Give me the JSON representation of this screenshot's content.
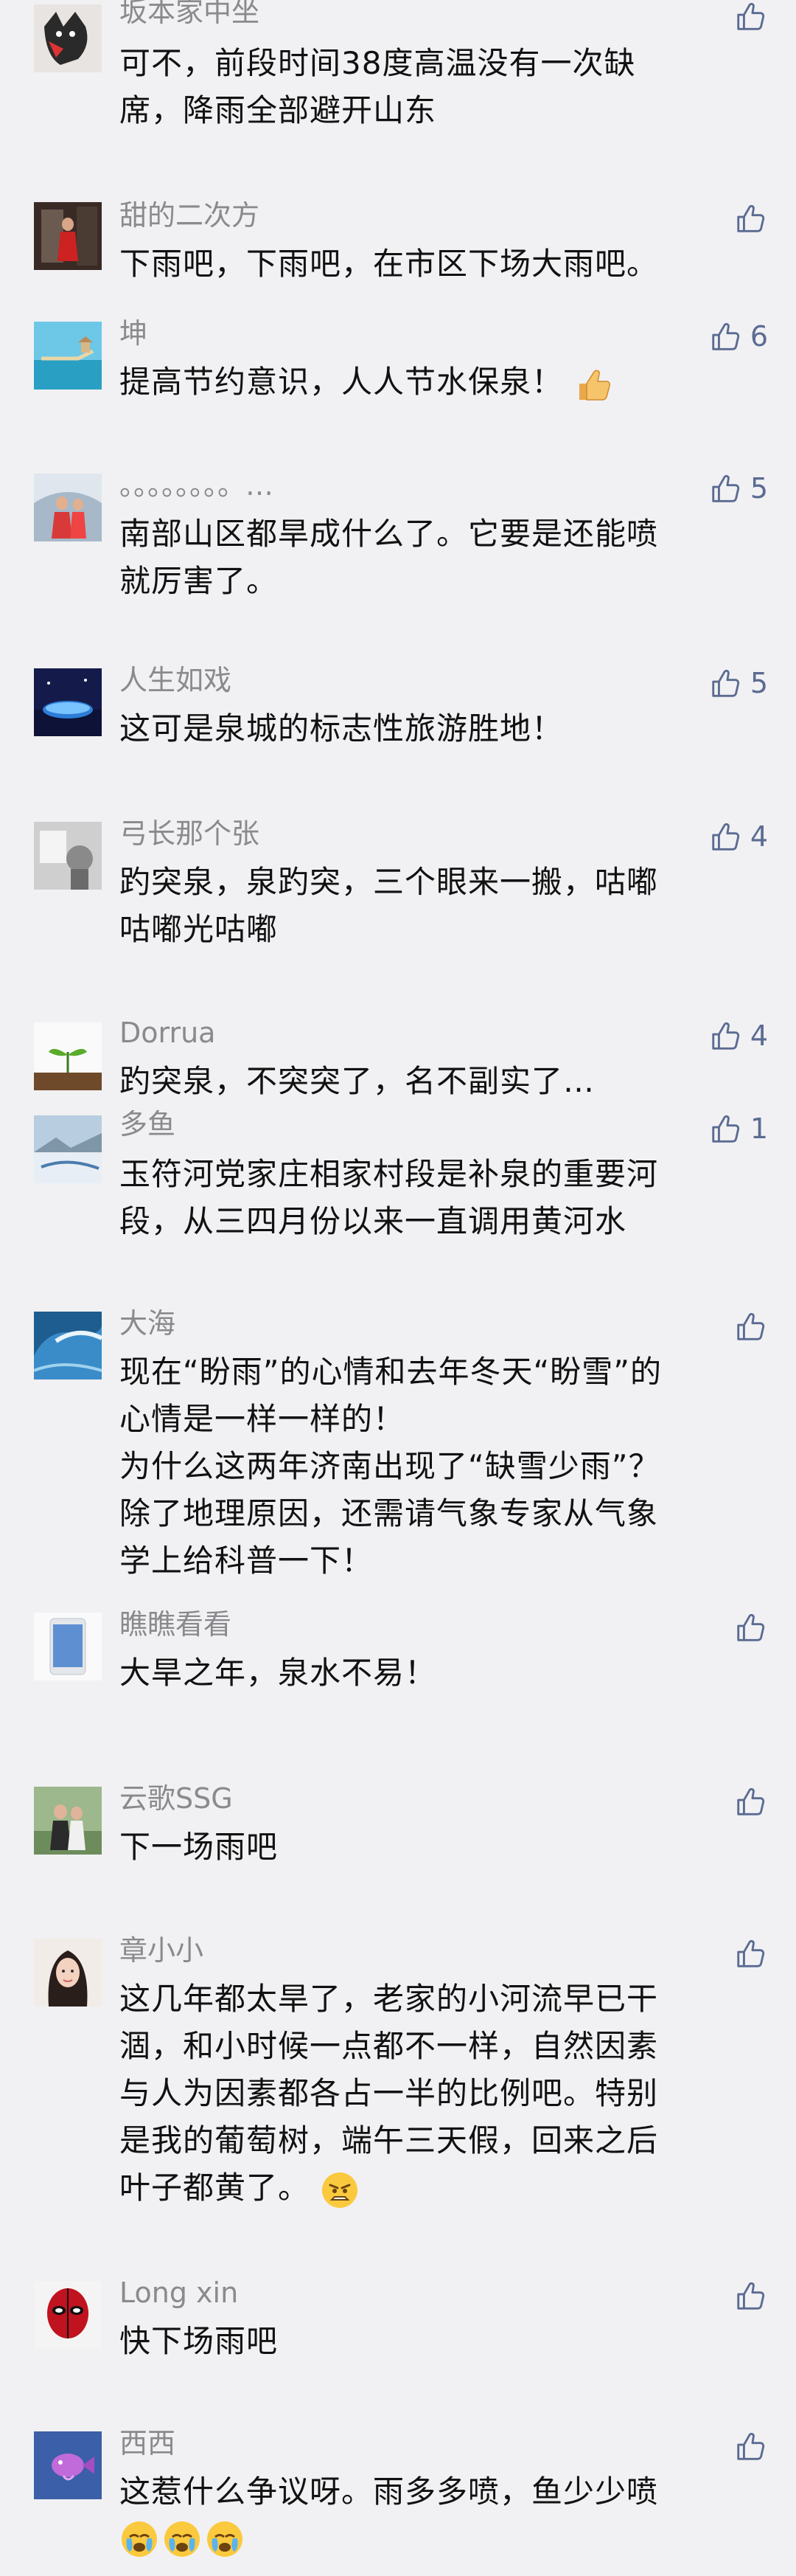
{
  "comments": [
    {
      "name": "坂本家中坐",
      "likes": "",
      "lines": [
        "可不，前段时间38度高温没有一次缺",
        "席，降雨全部避开山东"
      ]
    },
    {
      "name": "甜的二次方",
      "likes": "",
      "lines": [
        "下雨吧，下雨吧，在市区下场大雨吧。"
      ]
    },
    {
      "name": "坤",
      "likes": "6",
      "lines": [
        "提高节约意识，人人节水保泉！"
      ]
    },
    {
      "name": "。。。。。。。。…",
      "likes": "5",
      "lines": [
        "南部山区都旱成什么了。它要是还能喷",
        "就厉害了。"
      ]
    },
    {
      "name": "人生如戏",
      "likes": "5",
      "lines": [
        "这可是泉城的标志性旅游胜地！"
      ]
    },
    {
      "name": "弓长那个张",
      "likes": "4",
      "lines": [
        "趵突泉，泉趵突，三个眼来一搬，咕嘟",
        "咕嘟光咕嘟"
      ]
    },
    {
      "name": "Dorrua",
      "likes": "4",
      "lines": [
        "趵突泉，不突突了，名不副实了…"
      ]
    },
    {
      "name": "多鱼",
      "likes": "1",
      "lines": [
        "玉符河党家庄相家村段是补泉的重要河",
        "段，从三四月份以来一直调用黄河水"
      ]
    },
    {
      "name": "大海",
      "likes": "",
      "lines": [
        "现在“盼雨”的心情和去年冬天“盼雪”的",
        "心情是一样一样的！",
        "为什么这两年济南出现了“缺雪少雨”？",
        "除了地理原因，还需请气象专家从气象",
        "学上给科普一下！"
      ]
    },
    {
      "name": "瞧瞧看看",
      "likes": "",
      "lines": [
        "大旱之年，泉水不易！"
      ]
    },
    {
      "name": "云歌SSG",
      "likes": "",
      "lines": [
        "下一场雨吧"
      ]
    },
    {
      "name": "章小小",
      "likes": "",
      "lines": [
        "这几年都太旱了，老家的小河流早已干",
        "涸，和小时候一点都不一样，自然因素",
        "与人为因素都各占一半的比例吧。特别",
        "是我的葡萄树，端午三天假，回来之后",
        "叶子都黄了。"
      ]
    },
    {
      "name": "Long xin",
      "likes": "",
      "lines": [
        "快下场雨吧"
      ]
    },
    {
      "name": "西西",
      "likes": "",
      "lines": [
        "这惹什么争议呀。雨多多喷，鱼少少喷"
      ]
    }
  ],
  "icons": {
    "like": "thumbs-up-icon",
    "emoji_thumb": "thumbs-up-emoji",
    "emoji_angry": "angry-face-emoji",
    "emoji_cry": "crying-face-emoji"
  },
  "colors": {
    "background": "#f1f1f3",
    "name": "#8a8a8e",
    "body": "#111111",
    "like": "#5b6b92"
  }
}
